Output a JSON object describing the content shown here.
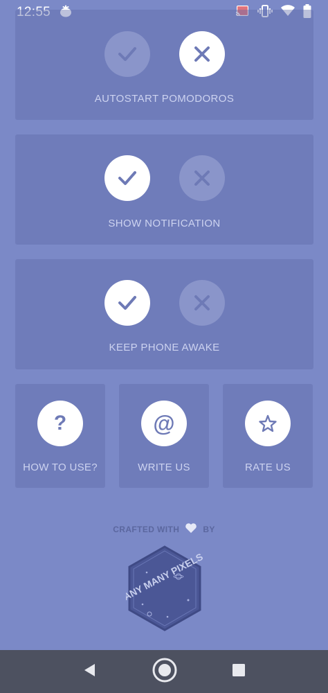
{
  "status_bar": {
    "time": "12:55",
    "icons": [
      "tomato-icon",
      "cast-icon",
      "vibrate-icon",
      "wifi-icon",
      "battery-icon"
    ]
  },
  "settings": [
    {
      "label": "AUTOSTART POMODOROS",
      "enabled": false
    },
    {
      "label": "SHOW NOTIFICATION",
      "enabled": true
    },
    {
      "label": "KEEP PHONE AWAKE",
      "enabled": true
    }
  ],
  "actions": [
    {
      "label": "HOW TO USE?",
      "icon": "question-icon",
      "glyph": "?"
    },
    {
      "label": "WRITE US",
      "icon": "at-icon",
      "glyph": "@"
    },
    {
      "label": "RATE US",
      "icon": "star-icon"
    }
  ],
  "footer": {
    "crafted_with": "CRAFTED WITH",
    "by": "BY",
    "logo_text": "MANY MANY PIXELS"
  },
  "colors": {
    "background": "#7b89c7",
    "card": "#6f7cbb",
    "icon": "#6e7ab6",
    "navbar": "#4d5160"
  }
}
